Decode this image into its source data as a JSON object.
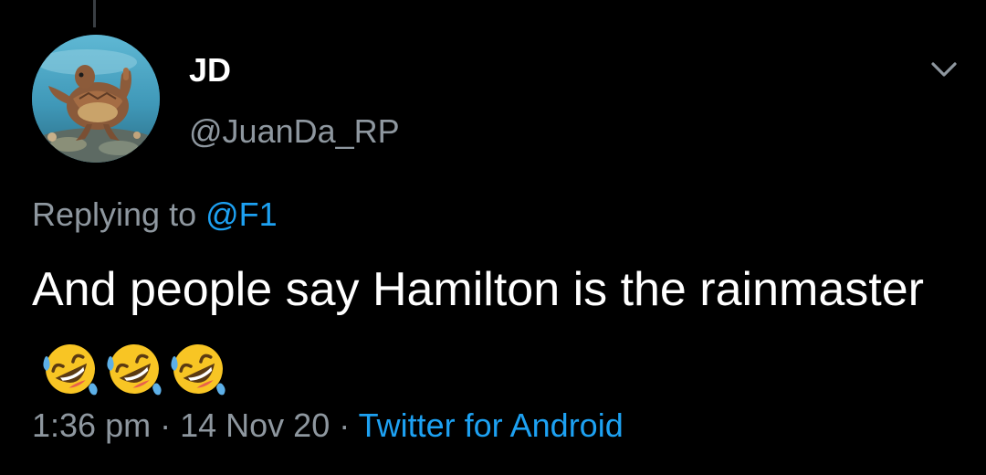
{
  "tweet": {
    "display_name": "JD",
    "handle": "@JuanDa_RP",
    "reply_prefix": "Replying to",
    "reply_mention": "@F1",
    "text": "And people say Hamilton is the rainmaster",
    "emoji_name": "rolling-on-the-floor-laughing-emoji",
    "emoji_count": 3,
    "time": "1:36 pm",
    "separator": "·",
    "date": "14 Nov 20",
    "source": "Twitter for Android"
  },
  "icons": {
    "caret": "chevron-down-icon",
    "avatar": "sea-turtle-avatar"
  },
  "colors": {
    "background": "#000000",
    "primary_text": "#ffffff",
    "secondary_text": "#8e979f",
    "link": "#1da1f2"
  }
}
